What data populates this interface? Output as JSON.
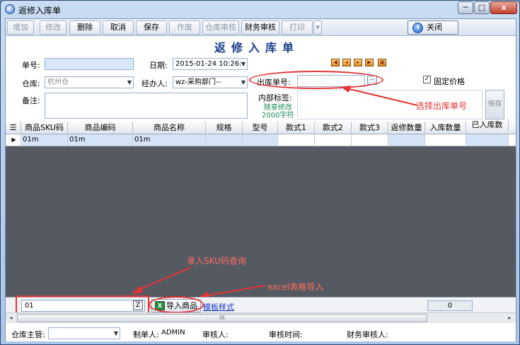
{
  "window": {
    "title": "返修入库单",
    "minimize": "─",
    "maximize": "□",
    "close": "x"
  },
  "toolbar": {
    "add": "增加",
    "edit": "修改",
    "delete": "删除",
    "cancel": "取消",
    "save": "保存",
    "void": "作废",
    "warehouse_audit": "仓库审核",
    "finance_audit": "财务审核",
    "print": "打印",
    "print_more": "▾",
    "close": "关闭"
  },
  "form": {
    "title": "返修入库单",
    "order_no_label": "单号:",
    "order_no_value": "",
    "date_label": "日期:",
    "date_value": "2015-01-24 10:26:",
    "warehouse_label": "仓库:",
    "warehouse_value": "杭州仓",
    "handler_label": "经办人:",
    "handler_value": "wz-采购部门--",
    "outbound_no_label": "出库单号:",
    "outbound_no_value": "",
    "fixed_price_label": "固定价格",
    "fixed_price_checked": true,
    "remark_label": "备注:",
    "internal_tag_label": "内部标签:",
    "internal_tag_hint_line1": "随意修改",
    "internal_tag_hint_line2": "2000字符",
    "side_save": "保存"
  },
  "annotations": {
    "select_outbound": "选择出库单号",
    "sku_query": "录入SKU码查询",
    "excel_import": "excel表格导入"
  },
  "grid": {
    "headers": [
      "商品SKU码",
      "商品编码",
      "商品名称",
      "规格",
      "型号",
      "款式1",
      "款式2",
      "款式3",
      "返修数量",
      "入库数量",
      "已入库数"
    ],
    "rows": [
      [
        "01m",
        "01m",
        "01m",
        "",
        "",
        "",
        "",
        "",
        "",
        "",
        ""
      ]
    ]
  },
  "bottombar": {
    "sku_input_value": "01",
    "z_button": "Z",
    "import_button": "导入商品",
    "template_link": "模板样式",
    "count": "0"
  },
  "scroll": {
    "left": "◂",
    "grip": "III",
    "right": "▸"
  },
  "footer": {
    "warehouse_manager_label": "仓库主管:",
    "warehouse_manager_value": "",
    "creator_label": "制单人:",
    "creator_value": "ADMIN",
    "auditor_label": "审核人:",
    "audit_time_label": "审核时间:",
    "finance_auditor_label": "财务审核人:"
  },
  "colors": {
    "accent": "#1c3f8a",
    "annotation": "#e33434",
    "grid_bg": "#555a62"
  }
}
